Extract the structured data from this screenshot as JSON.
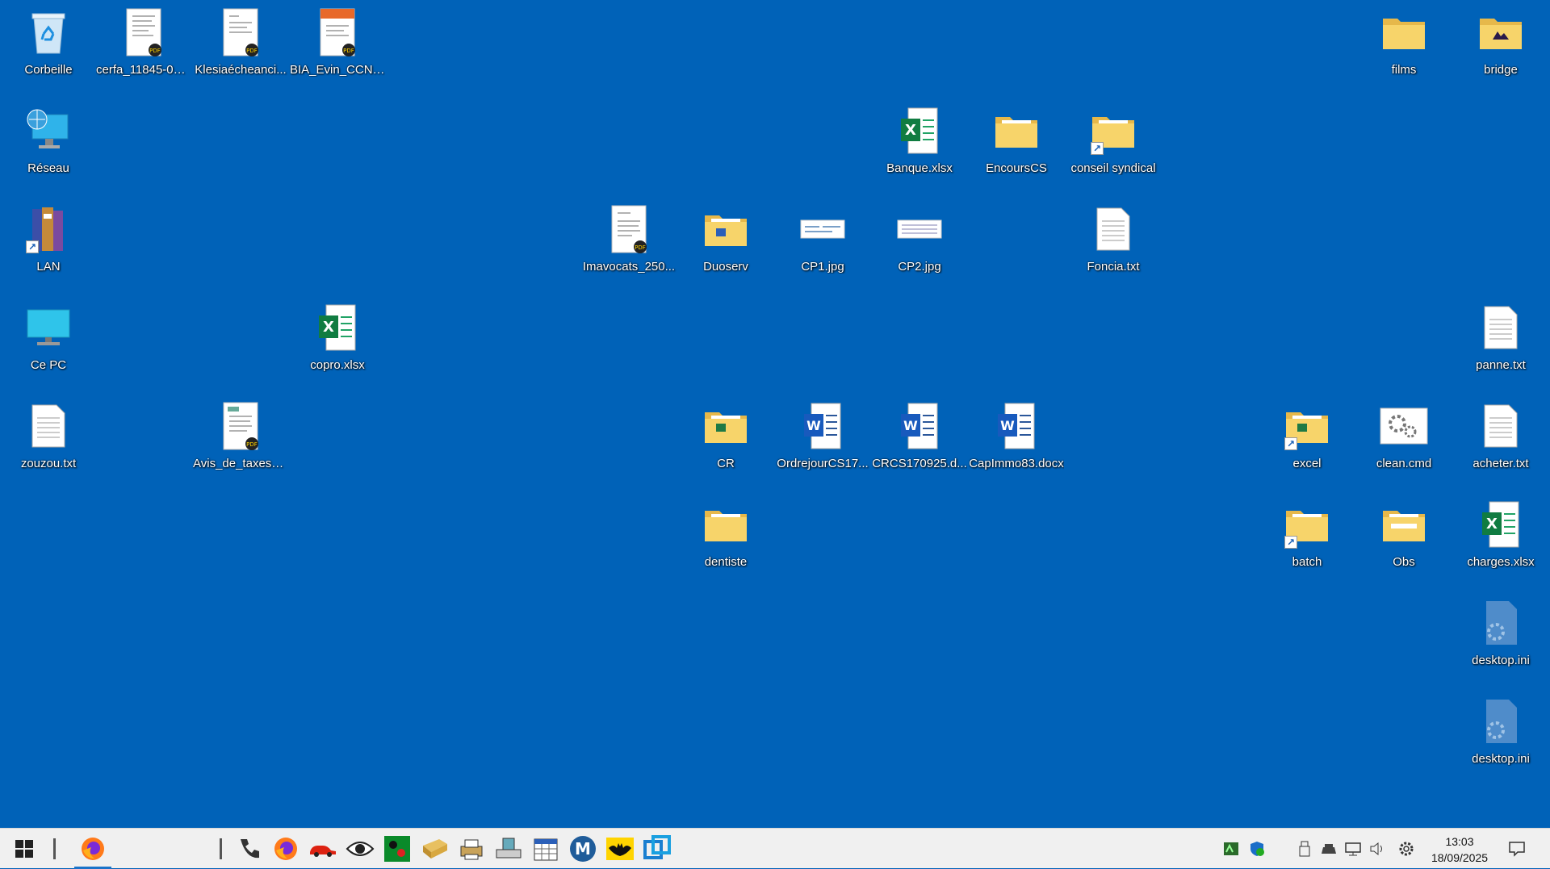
{
  "desktop": {
    "icons": {
      "corbeille": {
        "label": "Corbeille",
        "icon": "recycle-bin-icon"
      },
      "cerfa": {
        "label": "cerfa_11845-03....",
        "icon": "pdf-document-icon"
      },
      "klesia": {
        "label": "Klesiaécheanci...",
        "icon": "pdf-document-icon"
      },
      "bia": {
        "label": "BIA_Evin_CCN_...",
        "icon": "pdf-document-icon"
      },
      "films": {
        "label": "films",
        "icon": "folder-icon"
      },
      "bridge": {
        "label": "bridge",
        "icon": "folder-icon"
      },
      "reseau": {
        "label": "Réseau",
        "icon": "network-icon"
      },
      "banque": {
        "label": "Banque.xlsx",
        "icon": "excel-file-icon"
      },
      "encourscs": {
        "label": "EncoursCS",
        "icon": "folder-icon"
      },
      "conseil": {
        "label": "conseil syndical",
        "icon": "folder-shortcut-icon"
      },
      "lan": {
        "label": "LAN",
        "icon": "books-shortcut-icon"
      },
      "imavocats": {
        "label": "Imavocats_250...",
        "icon": "pdf-document-icon"
      },
      "duoserv": {
        "label": "Duoserv",
        "icon": "folder-icon"
      },
      "cp1": {
        "label": "CP1.jpg",
        "icon": "image-file-icon"
      },
      "cp2": {
        "label": "CP2.jpg",
        "icon": "image-file-icon"
      },
      "foncia": {
        "label": "Foncia.txt",
        "icon": "text-file-icon"
      },
      "cepc": {
        "label": "Ce PC",
        "icon": "computer-icon"
      },
      "copro": {
        "label": "copro.xlsx",
        "icon": "excel-file-icon"
      },
      "panne": {
        "label": "panne.txt",
        "icon": "text-file-icon"
      },
      "zouzou": {
        "label": "zouzou.txt",
        "icon": "text-file-icon"
      },
      "avis": {
        "label": "Avis_de_taxes_f...",
        "icon": "pdf-document-icon"
      },
      "cr": {
        "label": "CR",
        "icon": "folder-icon"
      },
      "ordrejour": {
        "label": "OrdrejourCS17...",
        "icon": "word-file-icon"
      },
      "crcs": {
        "label": "CRCS170925.d...",
        "icon": "word-file-icon"
      },
      "capimmo": {
        "label": "CapImmo83.docx",
        "icon": "word-file-icon"
      },
      "excel": {
        "label": "excel",
        "icon": "folder-shortcut-icon"
      },
      "clean": {
        "label": "clean.cmd",
        "icon": "cmd-file-icon"
      },
      "acheter": {
        "label": "acheter.txt",
        "icon": "text-file-icon"
      },
      "dentiste": {
        "label": "dentiste",
        "icon": "folder-icon"
      },
      "batch": {
        "label": "batch",
        "icon": "folder-shortcut-icon"
      },
      "obs": {
        "label": "Obs",
        "icon": "folder-icon"
      },
      "charges": {
        "label": "charges.xlsx",
        "icon": "excel-file-icon"
      },
      "desktopini1": {
        "label": "desktop.ini",
        "icon": "settings-file-icon"
      },
      "desktopini2": {
        "label": "desktop.ini",
        "icon": "settings-file-icon"
      }
    }
  },
  "taskbar": {
    "clock": {
      "time": "13:03",
      "date": "18/09/2025"
    },
    "colors": {
      "background": "#f0f0f0",
      "desktop": "#0062b8",
      "active_indicator": "#1a73c9"
    }
  }
}
